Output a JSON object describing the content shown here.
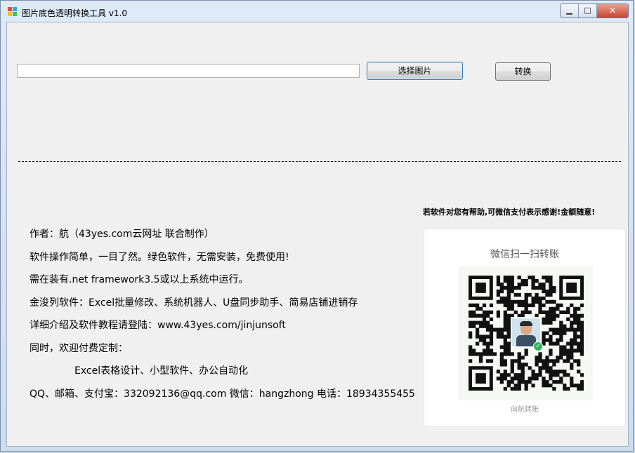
{
  "window": {
    "title": "图片底色透明转换工具 v1.0",
    "controls": {
      "minimize": "▁",
      "maximize": "□",
      "close": "✕"
    }
  },
  "toolbar": {
    "path_value": "",
    "select_label": "选择图片",
    "convert_label": "转换"
  },
  "thanks_text": "若软件对您有帮助,可微信支付表示感谢!金额随意!",
  "info_lines": [
    "作者：航（43yes.com云网址 联合制作）",
    "软件操作简单，一目了然。绿色软件，无需安装，免费使用!",
    "需在装有.net framework3.5或以上系统中运行。",
    "金浚列软件：Excel批量修改、系统机器人、U盘同步助手、简易店铺进销存",
    "详细介绍及软件教程请登陆：www.43yes.com/jinjunsoft",
    "同时，欢迎付费定制：",
    "Excel表格设计、小型软件、办公自动化",
    "QQ、邮箱、支付宝：332092136@qq.com  微信：hangzhong 电话：18934355455"
  ],
  "qr": {
    "title": "微信扫一扫转账",
    "caption": "向航转账"
  },
  "colors": {
    "frame": "#cddcef",
    "client": "#f0f0f0",
    "accent_button_border": "#3c7fb1"
  },
  "icons": {
    "app": "app-icon",
    "verified": "check-icon"
  }
}
